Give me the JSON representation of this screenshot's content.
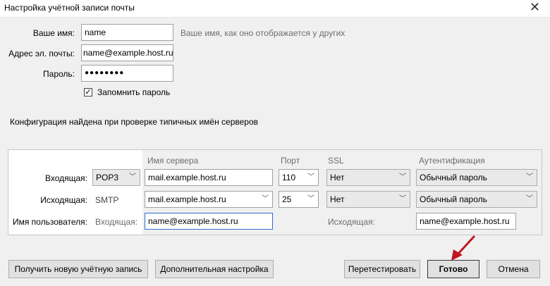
{
  "window": {
    "title": "Настройка учётной записи почты"
  },
  "form": {
    "name_label": "Ваше имя:",
    "name_value": "name",
    "name_hint": "Ваше имя, как оно отображается у других",
    "email_label": "Адрес эл. почты:",
    "email_value": "name@example.host.ru",
    "password_label": "Пароль:",
    "password_value": "●●●●●●●●",
    "remember_label": "Запомнить пароль",
    "remember_checked": "✓"
  },
  "status_message": "Конфигурация найдена при проверке типичных имён серверов",
  "servers": {
    "headers": {
      "server": "Имя сервера",
      "port": "Порт",
      "ssl": "SSL",
      "auth": "Аутентификация"
    },
    "incoming": {
      "label": "Входящая:",
      "protocol": "POP3",
      "server": "mail.example.host.ru",
      "port": "110",
      "ssl": "Нет",
      "auth": "Обычный пароль"
    },
    "outgoing": {
      "label": "Исходящая:",
      "protocol": "SMTP",
      "server": "mail.example.host.ru",
      "port": "25",
      "ssl": "Нет",
      "auth": "Обычный пароль"
    },
    "username": {
      "label": "Имя пользователя:",
      "incoming_label": "Входящая:",
      "incoming_value": "name@example.host.ru",
      "outgoing_label": "Исходящая:",
      "outgoing_value": "name@example.host.ru"
    }
  },
  "buttons": {
    "new_account": "Получить новую учётную запись",
    "advanced": "Дополнительная настройка",
    "retest": "Перетестировать",
    "done": "Готово",
    "cancel": "Отмена"
  },
  "colors": {
    "annotation_arrow": "#c0161c",
    "focus_border": "#2b6fcf"
  }
}
